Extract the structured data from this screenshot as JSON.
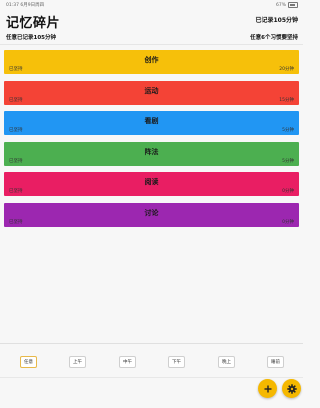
{
  "status_bar": {
    "time_date": "01:37  6月9日周四",
    "battery": "67%"
  },
  "header": {
    "title": "记忆碎片",
    "recorded_total": "已记录105分钟"
  },
  "subheader": {
    "left": "任意已记录105分钟",
    "right": "任意6个习惯要坚持"
  },
  "habits": [
    {
      "label": "创作",
      "left": "已坚持",
      "right": "20分钟",
      "color": "#f6c00a"
    },
    {
      "label": "运动",
      "left": "已坚持",
      "right": "15分钟",
      "color": "#f44336"
    },
    {
      "label": "看剧",
      "left": "已坚持",
      "right": "5分钟",
      "color": "#2196f3"
    },
    {
      "label": "阵法",
      "left": "已坚持",
      "right": "5分钟",
      "color": "#4caf50"
    },
    {
      "label": "阅读",
      "left": "已坚持",
      "right": "0分钟",
      "color": "#e91e63"
    },
    {
      "label": "讨论",
      "left": "已坚持",
      "right": "0分钟",
      "color": "#9c27b0"
    }
  ],
  "filters": [
    {
      "label": "任意",
      "active": true
    },
    {
      "label": "上午",
      "active": false
    },
    {
      "label": "中午",
      "active": false
    },
    {
      "label": "下午",
      "active": false
    },
    {
      "label": "晚上",
      "active": false
    },
    {
      "label": "睡前",
      "active": false
    }
  ],
  "actions": {
    "add_icon": "plus-icon",
    "settings_icon": "gear-icon",
    "accent": "#f5b800"
  }
}
